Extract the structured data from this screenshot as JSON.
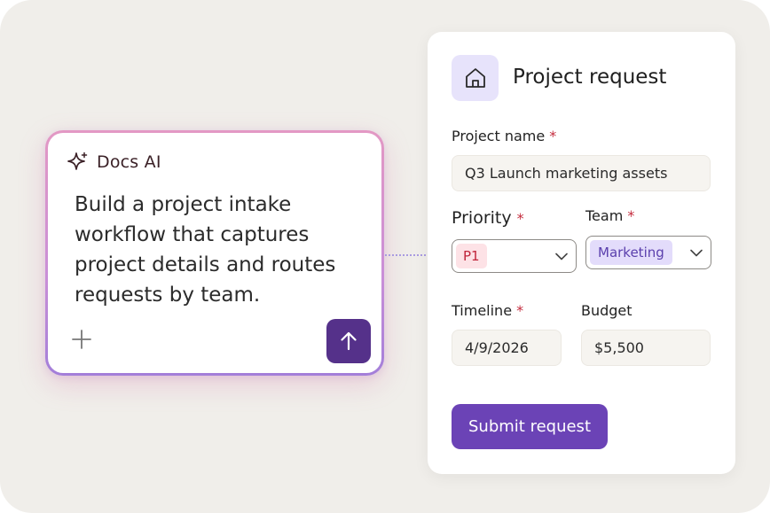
{
  "ai_panel": {
    "title": "Docs AI",
    "prompt": "Build a project intake workflow that captures project details and routes requests by team.",
    "icons": {
      "header": "sparkle-icon",
      "attach": "plus-icon",
      "send": "arrow-up-icon"
    },
    "send_button_color": "#55318a"
  },
  "form": {
    "title": "Project request",
    "icon": "home-icon",
    "required_marker": "*",
    "project_name": {
      "label": "Project name",
      "value": "Q3 Launch marketing assets"
    },
    "priority": {
      "label": "Priority",
      "value": "P1"
    },
    "team": {
      "label": "Team",
      "value": "Marketing"
    },
    "timeline": {
      "label": "Timeline",
      "value": "4/9/2026"
    },
    "budget": {
      "label": "Budget",
      "value": "$5,500"
    },
    "submit_label": "Submit request"
  },
  "colors": {
    "background": "#f0eeea",
    "accent": "#6b43b6",
    "required": "#c42b3d",
    "priority_chip_bg": "#fde2e6",
    "team_chip_bg": "#e3dcfb"
  }
}
